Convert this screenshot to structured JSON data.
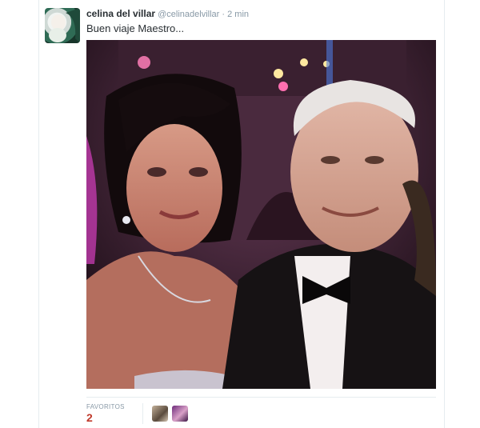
{
  "tweet": {
    "display_name": "celina del villar",
    "handle": "@celinadelvillar",
    "separator": "·",
    "time": "2 min",
    "text": "Buen viaje Maestro..."
  },
  "photo": {
    "icon": "photo-icon",
    "description_colors": {
      "background": "#2b1a24",
      "accent_pink": "#d63fbf",
      "lights": "#ffe8a0"
    }
  },
  "stats": {
    "favorites_label": "FAVORITOS",
    "favorites_count": "2"
  },
  "colors": {
    "name": "#292f33",
    "meta": "#8899a6",
    "count": "#c0392b",
    "border": "#e6ecf0"
  }
}
